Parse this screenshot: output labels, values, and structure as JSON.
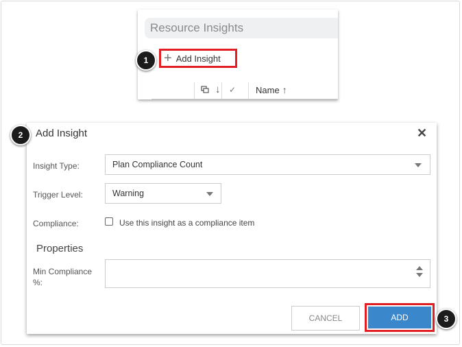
{
  "top_panel": {
    "title": "Resource Insights",
    "add_button_label": "Add Insight",
    "columns": {
      "name_label": "Name"
    }
  },
  "dialog": {
    "title": "Add Insight",
    "insight_type_label": "Insight Type:",
    "insight_type_value": "Plan Compliance Count",
    "trigger_level_label": "Trigger Level:",
    "trigger_level_value": "Warning",
    "compliance_label": "Compliance:",
    "compliance_checkbox_text": "Use this insight as a compliance item",
    "properties_heading": "Properties",
    "min_compliance_label": "Min Compliance %:",
    "min_compliance_value": "",
    "cancel_label": "CANCEL",
    "add_label": "ADD"
  },
  "callouts": [
    "1",
    "2",
    "3"
  ],
  "colors": {
    "highlight_red": "#e01e24",
    "primary_blue": "#3b87cc"
  }
}
